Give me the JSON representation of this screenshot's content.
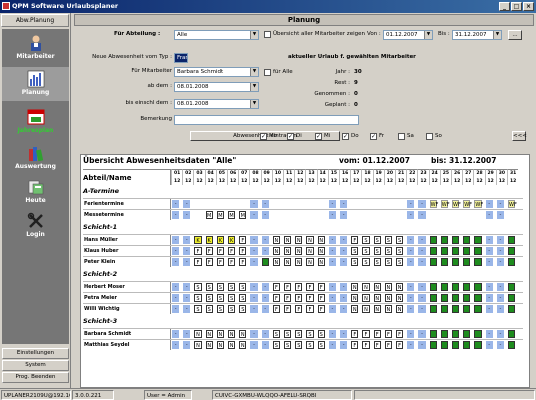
{
  "window": {
    "title": "QPM Software Urlaubsplaner",
    "buttons": [
      "_",
      "□",
      "×"
    ]
  },
  "sidebar": {
    "top_tab": "Abw.Planung",
    "items": [
      {
        "label": "Mitarbeiter",
        "icon": "person-icon"
      },
      {
        "label": "Planung",
        "icon": "chart-icon"
      },
      {
        "label": "Jahresplan",
        "icon": "calendar-icon"
      },
      {
        "label": "Auswertung",
        "icon": "books-icon"
      },
      {
        "label": "Heute",
        "icon": "today-icon"
      },
      {
        "label": "Login",
        "icon": "tools-icon"
      }
    ],
    "bottom": [
      "Einstellungen",
      "System",
      "Prog. Beenden"
    ]
  },
  "page_title": "Planung",
  "filter": {
    "abteilung_label": "Für Abteilung :",
    "abteilung_value": "Alle",
    "show_all_label": "Übersicht aller Mitarbeiter zeigen",
    "von_label": "Von :",
    "von_value": "01.12.2007",
    "bis_label": "Bis :",
    "bis_value": "31.12.2007",
    "dots": "..."
  },
  "form": {
    "typ_label": "Neue Abwesenheit vom Typ :",
    "typ_value": "Frank",
    "mitarbeiter_label": "Für Mitarbeiter",
    "mitarbeiter_value": "Barbara Schmidt",
    "fuer_alle_label": "für Alle",
    "ab_label": "ab dem :",
    "ab_value": "08.01.2008",
    "bis_label": "bis einschl dem :",
    "bis_value": "08.01.2008",
    "bemerkung_label": "Bemerkung",
    "submit": "Abwesenheit eintragen"
  },
  "urlaub": {
    "heading": "aktueller Urlaub f. gewählten Mitarbeiter",
    "rows": [
      {
        "label": "Jahr :",
        "value": "30"
      },
      {
        "label": "Rest :",
        "value": "9"
      },
      {
        "label": "Genommen :",
        "value": "0"
      },
      {
        "label": "Geplant :",
        "value": "0"
      }
    ]
  },
  "weekdays": [
    {
      "label": "Mo",
      "checked": true
    },
    {
      "label": "Di",
      "checked": true
    },
    {
      "label": "Mi",
      "checked": true
    },
    {
      "label": "Do",
      "checked": true
    },
    {
      "label": "Fr",
      "checked": true
    },
    {
      "label": "Sa",
      "checked": false
    },
    {
      "label": "So",
      "checked": false
    }
  ],
  "collapse": "<<<",
  "grid": {
    "title": "Übersicht Abwesenheitsdaten \"Alle\"",
    "von": "vom: 01.12.2007",
    "bis": "bis: 31.12.2007",
    "col_label": "Abteil/Name",
    "days": [
      "01",
      "02",
      "03",
      "04",
      "05",
      "06",
      "07",
      "08",
      "09",
      "10",
      "11",
      "12",
      "13",
      "14",
      "15",
      "16",
      "17",
      "18",
      "19",
      "20",
      "21",
      "22",
      "23",
      "24",
      "25",
      "26",
      "27",
      "28",
      "29",
      "30",
      "31"
    ],
    "month": "12",
    "colors": {
      "weekend": "#9ab6e8",
      "holiday": "#1e8c1e",
      "K": "#f2f230",
      "WF": "#f2f29c",
      "border": "#333"
    },
    "groups": [
      {
        "name": "A-Termine",
        "rows": [
          {
            "name": "Ferientermine",
            "cells": [
              "-",
              "-",
              "",
              "",
              "",
              "",
              "",
              "-",
              "-",
              "",
              "",
              "",
              "",
              "",
              "-",
              "-",
              "",
              "",
              "",
              "",
              "",
              "-",
              "-",
              "WF",
              "WF",
              "WF",
              "WF",
              "WF",
              "-",
              "-",
              "WF"
            ]
          },
          {
            "name": "Messetermine",
            "cells": [
              "-",
              "-",
              "",
              "M",
              "M",
              "M",
              "M",
              "-",
              "-",
              "",
              "",
              "",
              "",
              "",
              "-",
              "-",
              "",
              "",
              "",
              "",
              "",
              "-",
              "-",
              "",
              "",
              "",
              "",
              "",
              "-",
              "-",
              ""
            ]
          }
        ]
      },
      {
        "name": "Schicht-1",
        "rows": [
          {
            "name": "Hans Müller",
            "cells": [
              "-",
              "-",
              "K",
              "K",
              "K",
              "K",
              "F",
              "-",
              "-",
              "N",
              "N",
              "N",
              "N",
              "N",
              "-",
              "-",
              "F",
              "S",
              "S",
              "S",
              "S",
              "-",
              "-",
              "H",
              "H",
              "H",
              "H",
              "H",
              "-",
              "-",
              "H"
            ]
          },
          {
            "name": "Klaus Huber",
            "cells": [
              "-",
              "-",
              "F",
              "F",
              "F",
              "F",
              "F",
              "-",
              "-",
              "N",
              "N",
              "N",
              "N",
              "N",
              "-",
              "-",
              "S",
              "S",
              "S",
              "S",
              "S",
              "-",
              "-",
              "H",
              "H",
              "H",
              "H",
              "H",
              "-",
              "-",
              "H"
            ]
          },
          {
            "name": "Peter Klein",
            "cells": [
              "-",
              "-",
              "F",
              "F",
              "F",
              "F",
              "F",
              "-",
              "H",
              "N",
              "N",
              "N",
              "N",
              "N",
              "-",
              "-",
              "S",
              "S",
              "S",
              "S",
              "S",
              "-",
              "-",
              "H",
              "H",
              "H",
              "H",
              "H",
              "-",
              "-",
              "H"
            ]
          }
        ]
      },
      {
        "name": "Schicht-2",
        "rows": [
          {
            "name": "Herbert Moser",
            "cells": [
              "-",
              "-",
              "S",
              "S",
              "S",
              "S",
              "S",
              "-",
              "-",
              "F",
              "F",
              "F",
              "F",
              "F",
              "-",
              "-",
              "N",
              "N",
              "N",
              "N",
              "N",
              "-",
              "-",
              "H",
              "H",
              "H",
              "H",
              "H",
              "-",
              "-",
              "H"
            ]
          },
          {
            "name": "Petra Meier",
            "cells": [
              "-",
              "-",
              "S",
              "S",
              "S",
              "S",
              "S",
              "-",
              "-",
              "F",
              "F",
              "F",
              "F",
              "F",
              "-",
              "-",
              "N",
              "N",
              "N",
              "N",
              "N",
              "-",
              "-",
              "H",
              "H",
              "H",
              "H",
              "H",
              "-",
              "-",
              "H"
            ]
          },
          {
            "name": "Willi Wichtig",
            "cells": [
              "-",
              "-",
              "S",
              "S",
              "S",
              "S",
              "S",
              "-",
              "-",
              "F",
              "F",
              "F",
              "F",
              "F",
              "-",
              "-",
              "N",
              "N",
              "N",
              "N",
              "N",
              "-",
              "-",
              "H",
              "H",
              "H",
              "H",
              "H",
              "-",
              "-",
              "H"
            ]
          }
        ]
      },
      {
        "name": "Schicht-3",
        "rows": [
          {
            "name": "Barbara Schmidt",
            "cells": [
              "-",
              "-",
              "N",
              "N",
              "N",
              "N",
              "N",
              "-",
              "-",
              "S",
              "S",
              "S",
              "S",
              "S",
              "-",
              "-",
              "F",
              "F",
              "F",
              "F",
              "F",
              "-",
              "-",
              "H",
              "H",
              "H",
              "H",
              "H",
              "-",
              "-",
              "H"
            ]
          },
          {
            "name": "Matthias Seydel",
            "cells": [
              "-",
              "-",
              "N",
              "N",
              "N",
              "N",
              "N",
              "-",
              "-",
              "S",
              "S",
              "S",
              "S",
              "S",
              "-",
              "-",
              "F",
              "F",
              "F",
              "F",
              "F",
              "-",
              "-",
              "H",
              "H",
              "H",
              "H",
              "H",
              "-",
              "-",
              "H"
            ]
          }
        ]
      }
    ]
  },
  "status": {
    "host": "UPLANER2109U@192.16",
    "version": "3.0.0.221",
    "user": "User = Admin",
    "key": "CUIVC-GXMBU-WLQQO-AFELU-SRQBI"
  }
}
